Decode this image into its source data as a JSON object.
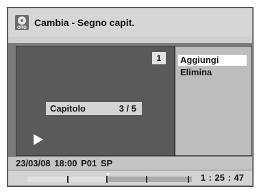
{
  "header": {
    "icon": "org-icon",
    "icon_label": "ORG",
    "title": "Cambia - Segno capit."
  },
  "preview": {
    "title_number": "1",
    "chapter_label": "Capitolo",
    "chapter_value": "3 / 5",
    "status_icon": "play-icon"
  },
  "menu": {
    "items": [
      {
        "label": "Aggiungi",
        "selected": true
      },
      {
        "label": "Elimina",
        "selected": false
      }
    ]
  },
  "info": {
    "text": "23/03/08  18:00  P01  SP"
  },
  "timeline": {
    "progress_fraction": 0.49,
    "chapter_marks_fraction": [
      0.24,
      0.48,
      0.72,
      0.975
    ],
    "time": "1 : 25 : 47"
  },
  "colors": {
    "screen_bg": "#7a7a7a",
    "header_bg": "#d6d6d6",
    "preview_bg": "#5a5a5a",
    "menu_bg": "#bdbdbd",
    "selected_bg": "#ffffff"
  }
}
